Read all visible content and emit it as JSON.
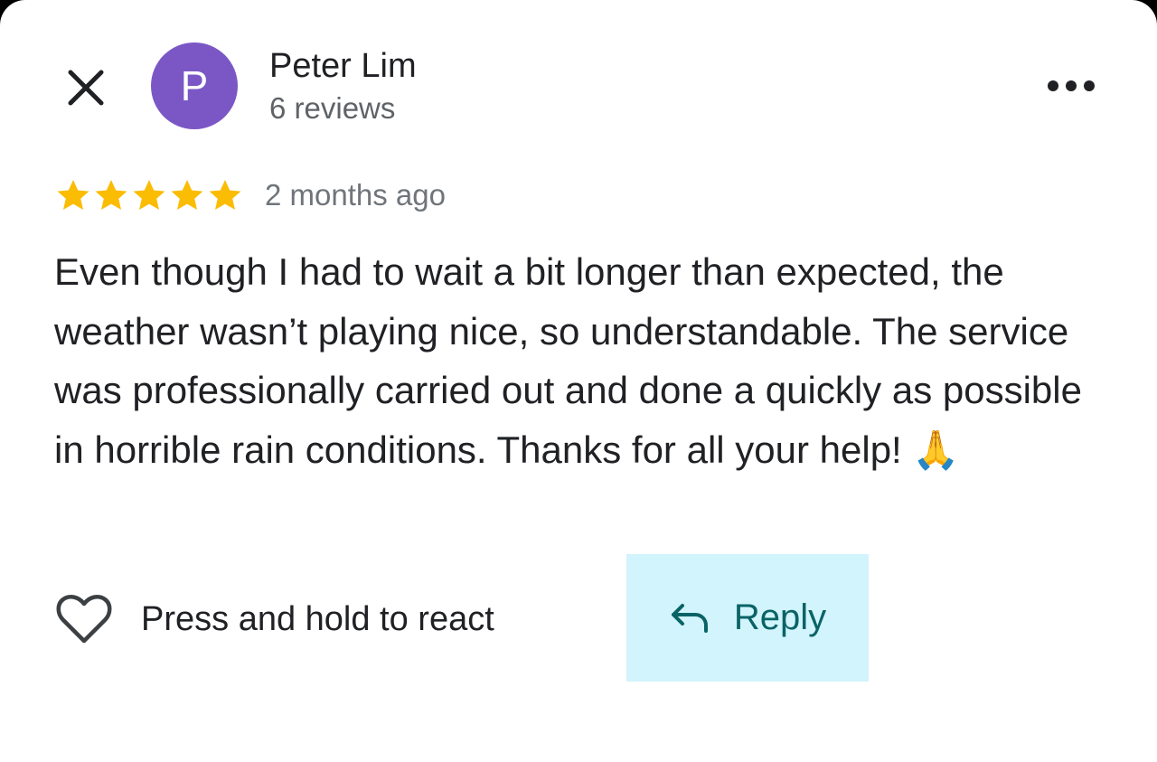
{
  "review": {
    "author": {
      "initial": "P",
      "name": "Peter Lim",
      "review_count": "6 reviews"
    },
    "rating": 5,
    "max_rating": 5,
    "time_ago": "2 months ago",
    "text": "Even though I had to wait a bit longer than expected, the weather wasn’t playing nice, so understandable. The service was professionally carried out and done a quickly as possible in horrible rain conditions. Thanks for all your help! 🙏"
  },
  "actions": {
    "react_label": "Press and hold to react",
    "reply_label": "Reply"
  },
  "icons": {
    "close": "close-icon",
    "more": "more-horizontal-icon",
    "star": "star-icon",
    "heart": "heart-outline-icon",
    "reply": "reply-arrow-icon"
  },
  "colors": {
    "avatar_bg": "#7b57c6",
    "star": "#fbbc04",
    "reply_bg": "#d2f4fc",
    "reply_text": "#0a6366",
    "primary_text": "#202124",
    "secondary_text": "#5f6368"
  }
}
